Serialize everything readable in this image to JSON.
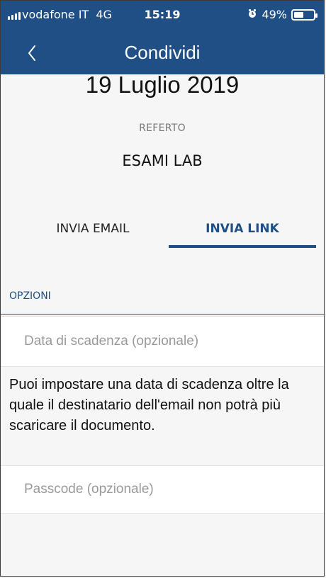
{
  "status_bar": {
    "carrier": "vodafone IT",
    "network": "4G",
    "time": "15:19",
    "battery": "49%",
    "battery_level": 0.49
  },
  "nav": {
    "back_icon": "chevron-left-icon",
    "title": "Condividi"
  },
  "document": {
    "date": "19 Luglio 2019",
    "type_label": "REFERTO",
    "type_value": "ESAMI LAB"
  },
  "tabs": [
    {
      "label": "INVIA EMAIL",
      "active": false
    },
    {
      "label": "INVIA LINK",
      "active": true
    }
  ],
  "options": {
    "section_label": "OPZIONI",
    "expiry_placeholder": "Data di scadenza (opzionale)",
    "expiry_value": "",
    "hint": "Puoi impostare una data di scadenza oltre la quale il destinatario dell'email non potrà più scaricare il documento.",
    "passcode_placeholder": "Passcode (opzionale)",
    "passcode_value": ""
  },
  "colors": {
    "primary": "#1f4f85",
    "background": "#f6f6f6"
  }
}
